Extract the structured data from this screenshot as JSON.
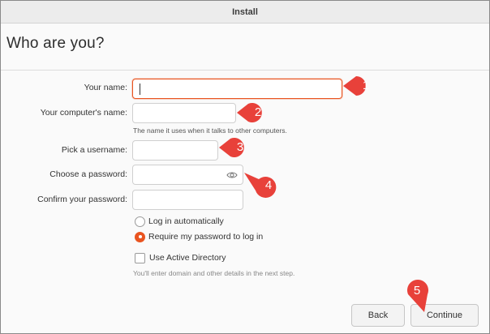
{
  "window": {
    "title": "Install"
  },
  "page": {
    "title": "Who are you?"
  },
  "form": {
    "name_label": "Your name:",
    "name_value": "",
    "computer_label": "Your computer's name:",
    "computer_hint": "The name it uses when it talks to other computers.",
    "username_label": "Pick a username:",
    "password_label": "Choose a password:",
    "confirm_label": "Confirm your password:",
    "login_auto_label": "Log in automatically",
    "login_password_label": "Require my password to log in",
    "login_selected": "Require my password to log in",
    "active_directory_label": "Use Active Directory",
    "active_directory_checked": false,
    "active_directory_hint": "You'll enter domain and other details in the next step."
  },
  "buttons": {
    "back": "Back",
    "continue": "Continue"
  },
  "markers": [
    "1",
    "2",
    "3",
    "4",
    "5"
  ],
  "colors": {
    "accent": "#e95420",
    "marker": "#e8413a"
  },
  "icons": {
    "password_toggle": "eye-icon"
  }
}
